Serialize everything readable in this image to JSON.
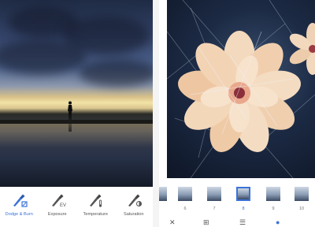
{
  "left_tools": [
    {
      "label": "Dodge & Burn",
      "icon": "dodge-burn-brush-icon",
      "active": true
    },
    {
      "label": "Exposure",
      "icon": "exposure-brush-icon",
      "active": false
    },
    {
      "label": "Temperature",
      "icon": "temperature-brush-icon",
      "active": false
    },
    {
      "label": "Saturation",
      "icon": "saturation-brush-icon",
      "active": false
    }
  ],
  "filters": [
    {
      "number": "",
      "selected": false
    },
    {
      "number": "6",
      "selected": false
    },
    {
      "number": "7",
      "selected": false
    },
    {
      "number": "8",
      "selected": true
    },
    {
      "number": "9",
      "selected": false
    },
    {
      "number": "10",
      "selected": false
    }
  ],
  "bottom_bar_icons": [
    "close-icon",
    "grid-pattern-icon",
    "sliders-icon",
    "style-brush-icon"
  ],
  "colors": {
    "accent": "#3b73d8",
    "label": "#555555"
  }
}
